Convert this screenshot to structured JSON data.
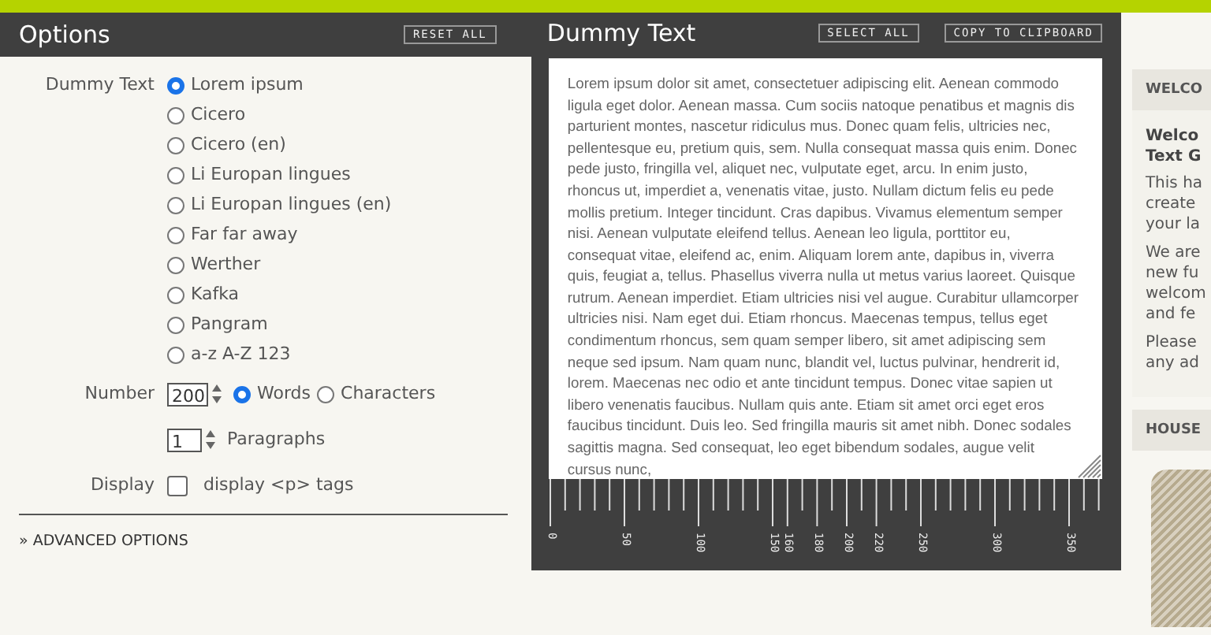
{
  "options": {
    "title": "Options",
    "reset_button": "RESET ALL",
    "dummy_text": {
      "label": "Dummy Text",
      "choices": [
        {
          "label": "Lorem ipsum",
          "selected": true
        },
        {
          "label": "Cicero",
          "selected": false
        },
        {
          "label": "Cicero (en)",
          "selected": false
        },
        {
          "label": "Li Europan lingues",
          "selected": false
        },
        {
          "label": "Li Europan lingues (en)",
          "selected": false
        },
        {
          "label": "Far far away",
          "selected": false
        },
        {
          "label": "Werther",
          "selected": false
        },
        {
          "label": "Kafka",
          "selected": false
        },
        {
          "label": "Pangram",
          "selected": false
        },
        {
          "label": "a-z A-Z 123",
          "selected": false
        }
      ]
    },
    "number": {
      "label": "Number",
      "value": "200",
      "units": [
        {
          "label": "Words",
          "selected": true
        },
        {
          "label": "Characters",
          "selected": false
        }
      ]
    },
    "paragraphs": {
      "value": "1",
      "label": "Paragraphs"
    },
    "display": {
      "label": "Display",
      "option": "display <p> tags",
      "checked": false
    },
    "advanced": "» ADVANCED OPTIONS"
  },
  "output": {
    "title": "Dummy Text",
    "buttons": [
      "SELECT ALL",
      "COPY TO CLIPBOARD"
    ],
    "text": "Lorem ipsum dolor sit amet, consectetuer adipiscing elit. Aenean commodo ligula eget dolor. Aenean massa. Cum sociis natoque penatibus et magnis dis parturient montes, nascetur ridiculus mus. Donec quam felis, ultricies nec, pellentesque eu, pretium quis, sem. Nulla consequat massa quis enim. Donec pede justo, fringilla vel, aliquet nec, vulputate eget, arcu. In enim justo, rhoncus ut, imperdiet a, venenatis vitae, justo. Nullam dictum felis eu pede mollis pretium. Integer tincidunt. Cras dapibus. Vivamus elementum semper nisi. Aenean vulputate eleifend tellus. Aenean leo ligula, porttitor eu, consequat vitae, eleifend ac, enim. Aliquam lorem ante, dapibus in, viverra quis, feugiat a, tellus. Phasellus viverra nulla ut metus varius laoreet. Quisque rutrum. Aenean imperdiet. Etiam ultricies nisi vel augue. Curabitur ullamcorper ultricies nisi. Nam eget dui. Etiam rhoncus. Maecenas tempus, tellus eget condimentum rhoncus, sem quam semper libero, sit amet adipiscing sem neque sed ipsum. Nam quam nunc, blandit vel, luctus pulvinar, hendrerit id, lorem. Maecenas nec odio et ante tincidunt tempus. Donec vitae sapien ut libero venenatis faucibus. Nullam quis ante. Etiam sit amet orci eget eros faucibus tincidunt. Duis leo. Sed fringilla mauris sit amet nibh. Donec sodales sagittis magna. Sed consequat, leo eget bibendum sodales, augue velit cursus nunc,",
    "ruler_labels": [
      "0",
      "50",
      "100",
      "150",
      "160",
      "180",
      "200",
      "220",
      "250",
      "300",
      "350"
    ]
  },
  "sidebar": {
    "welcome_header": "WELCO",
    "welcome_title": [
      "Welco",
      "Text G"
    ],
    "paragraphs": [
      [
        "This ha",
        "create",
        "your la"
      ],
      [
        "We are",
        "new fu",
        "welcom",
        "and fe"
      ],
      [
        "Please",
        "any ad"
      ]
    ],
    "second_header": "HOUSE"
  }
}
